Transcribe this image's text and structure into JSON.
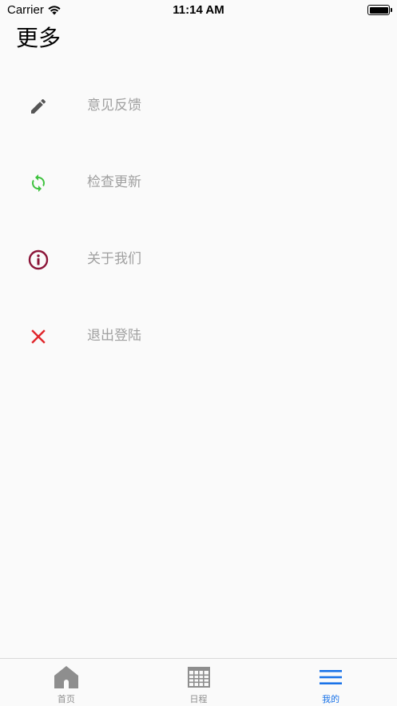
{
  "status_bar": {
    "carrier": "Carrier",
    "time": "11:14 AM"
  },
  "header": {
    "title": "更多"
  },
  "menu": {
    "items": [
      {
        "label": "意见反馈",
        "icon": "pencil-icon",
        "icon_color": "#555555"
      },
      {
        "label": "检查更新",
        "icon": "refresh-icon",
        "icon_color": "#3ec23e"
      },
      {
        "label": "关于我们",
        "icon": "info-icon",
        "icon_color": "#8b1538"
      },
      {
        "label": "退出登陆",
        "icon": "close-icon",
        "icon_color": "#e0262b"
      }
    ]
  },
  "tab_bar": {
    "tabs": [
      {
        "label": "首页",
        "icon": "home-icon",
        "active": false
      },
      {
        "label": "日程",
        "icon": "calendar-icon",
        "active": false
      },
      {
        "label": "我的",
        "icon": "menu-icon",
        "active": true
      }
    ],
    "active_color": "#1a73e8",
    "inactive_color": "#8e8e8e"
  }
}
